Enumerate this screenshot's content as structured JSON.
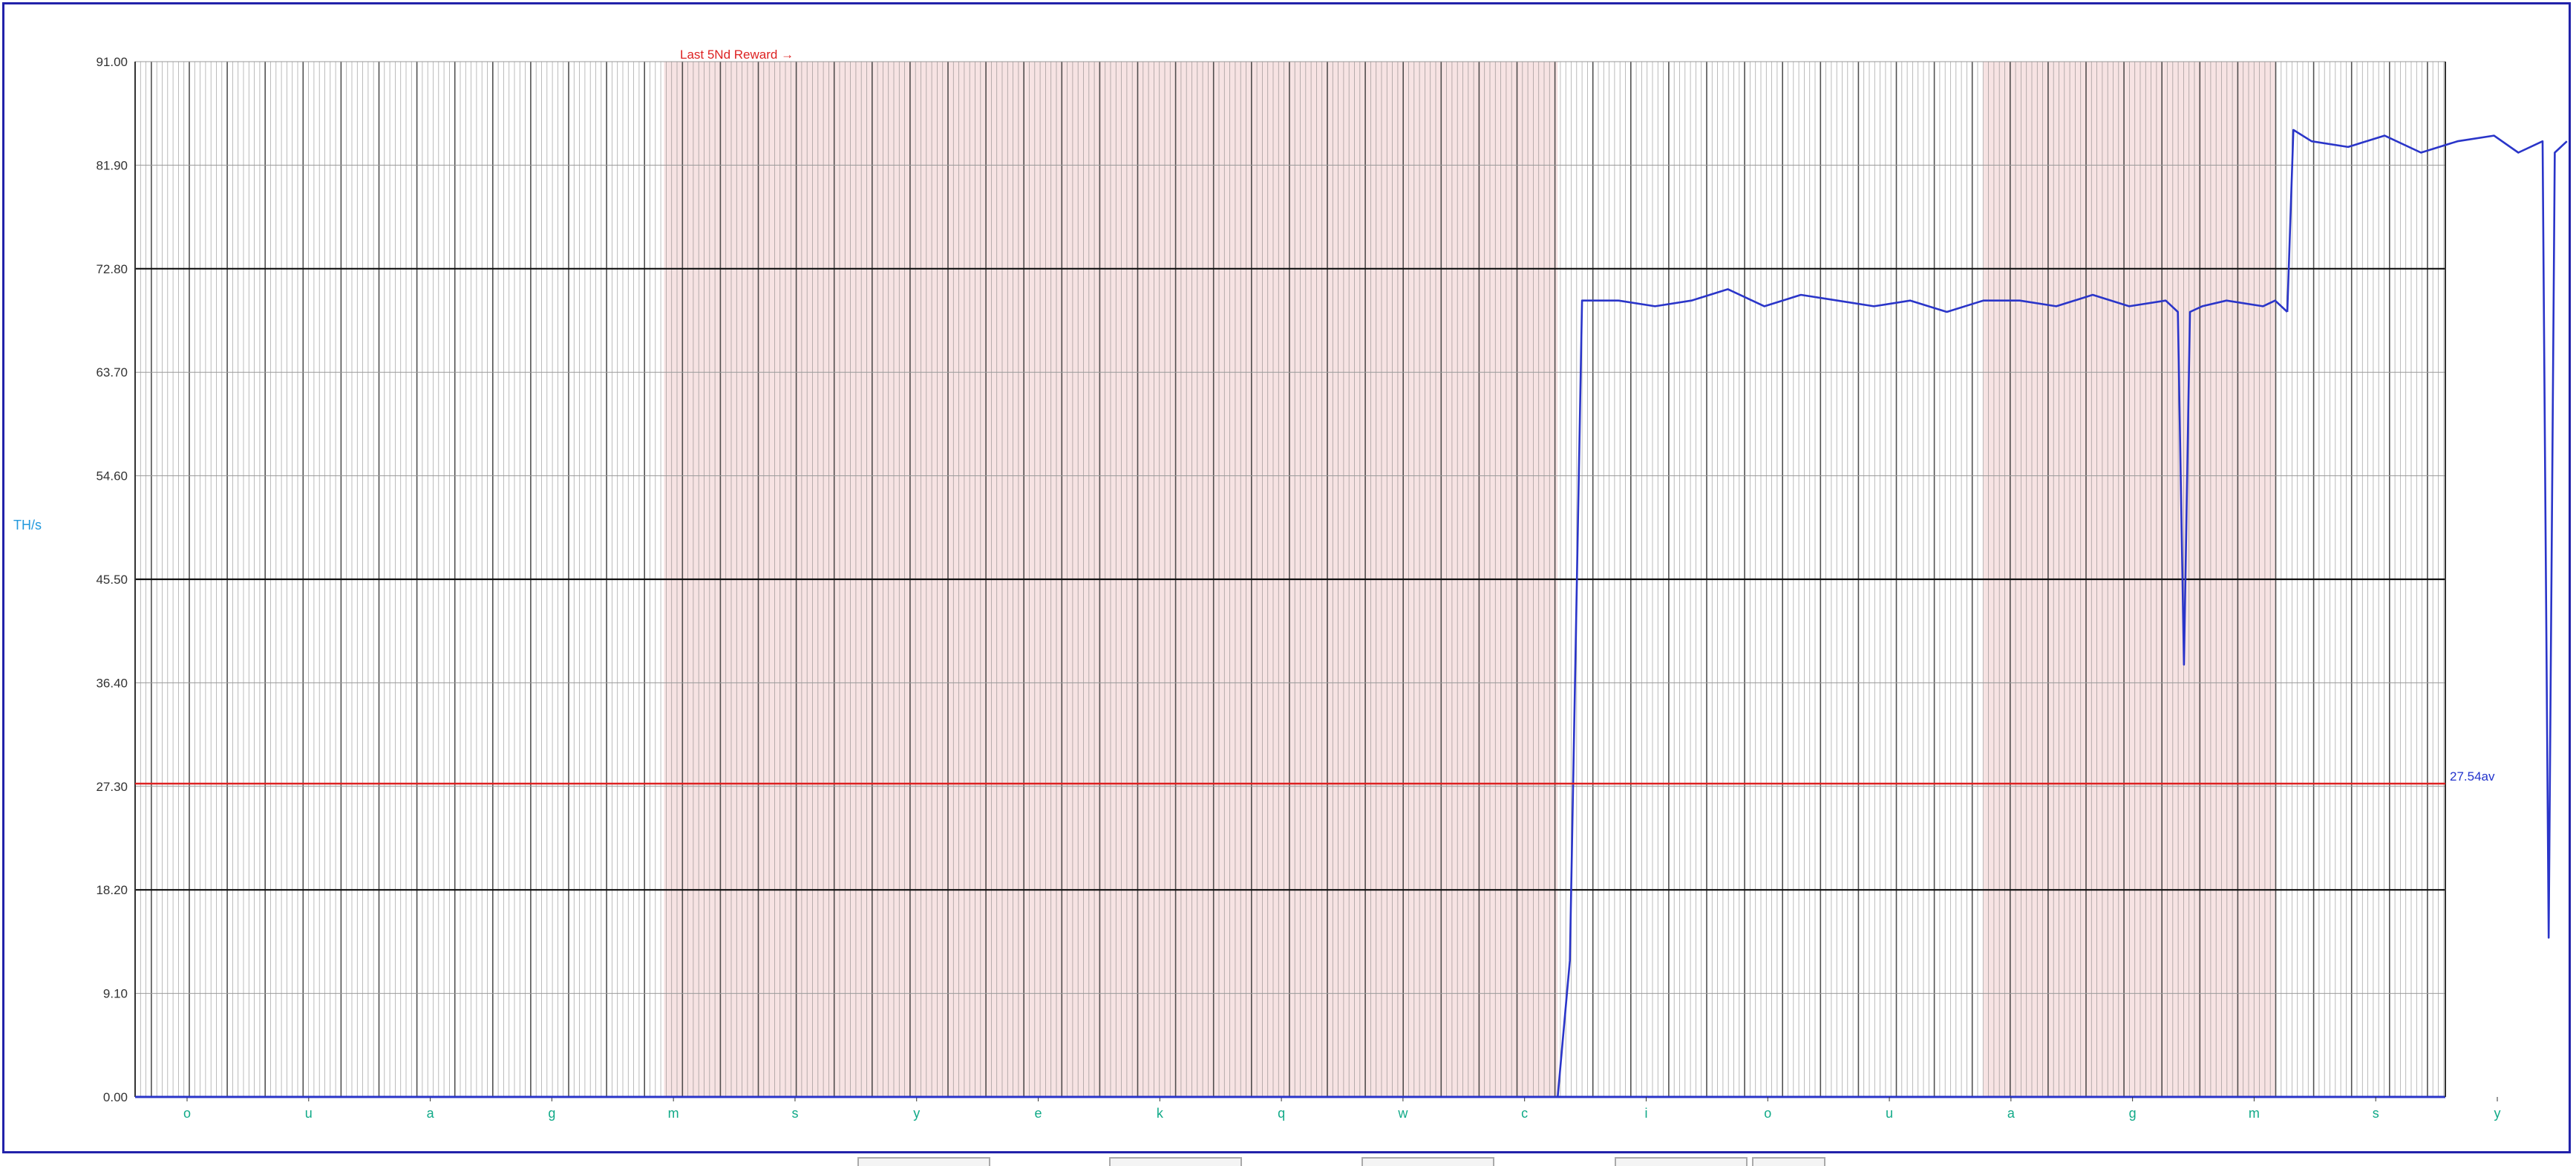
{
  "chart_data": {
    "type": "line",
    "ylabel": "TH/s",
    "ylim": [
      0,
      91
    ],
    "y_ticks": [
      "0.00",
      "9.10",
      "18.20",
      "27.30",
      "36.40",
      "45.50",
      "54.60",
      "63.70",
      "72.80",
      "81.90",
      "91.00"
    ],
    "x_ticks": [
      "o",
      "u",
      "a",
      "g",
      "m",
      "s",
      "y",
      "e",
      "k",
      "q",
      "w",
      "c",
      "i",
      "o",
      "u",
      "a",
      "g",
      "m",
      "s",
      "y"
    ],
    "annotation": "Last 5Nd Reward →",
    "average": {
      "value": 27.54,
      "label": "27.54av",
      "color": "#dd2222"
    },
    "series": [
      {
        "color": "#2a35c9",
        "segments": [
          {
            "x": [
              0,
              11.6,
              11.7,
              12.0
            ],
            "y": [
              0,
              0,
              0,
              0
            ]
          },
          {
            "x": [
              11.7,
              11.8,
              11.9,
              12.2,
              12.5,
              12.8,
              13.1,
              13.4,
              13.7,
              14.0,
              14.3,
              14.6,
              14.9,
              15.2,
              15.5,
              15.8,
              16.1,
              16.4,
              16.7,
              16.8,
              16.85,
              16.9,
              17.0,
              17.2,
              17.5,
              17.6,
              17.7
            ],
            "y": [
              0,
              12,
              70,
              70,
              69.5,
              70,
              71,
              69.5,
              70.5,
              70,
              69.5,
              70,
              69,
              70,
              70,
              69.5,
              70.5,
              69.5,
              70,
              69,
              38,
              69,
              69.5,
              70,
              69.5,
              70,
              69
            ]
          },
          {
            "x": [
              17.7,
              17.75,
              17.9,
              18.2,
              18.5,
              18.8,
              19.1,
              19.4,
              19.6,
              19.8,
              19.85,
              19.9,
              20.0
            ],
            "y": [
              69,
              85,
              84,
              83.5,
              84.5,
              83,
              84,
              84.5,
              83,
              84,
              14,
              83,
              84
            ]
          }
        ]
      }
    ]
  }
}
